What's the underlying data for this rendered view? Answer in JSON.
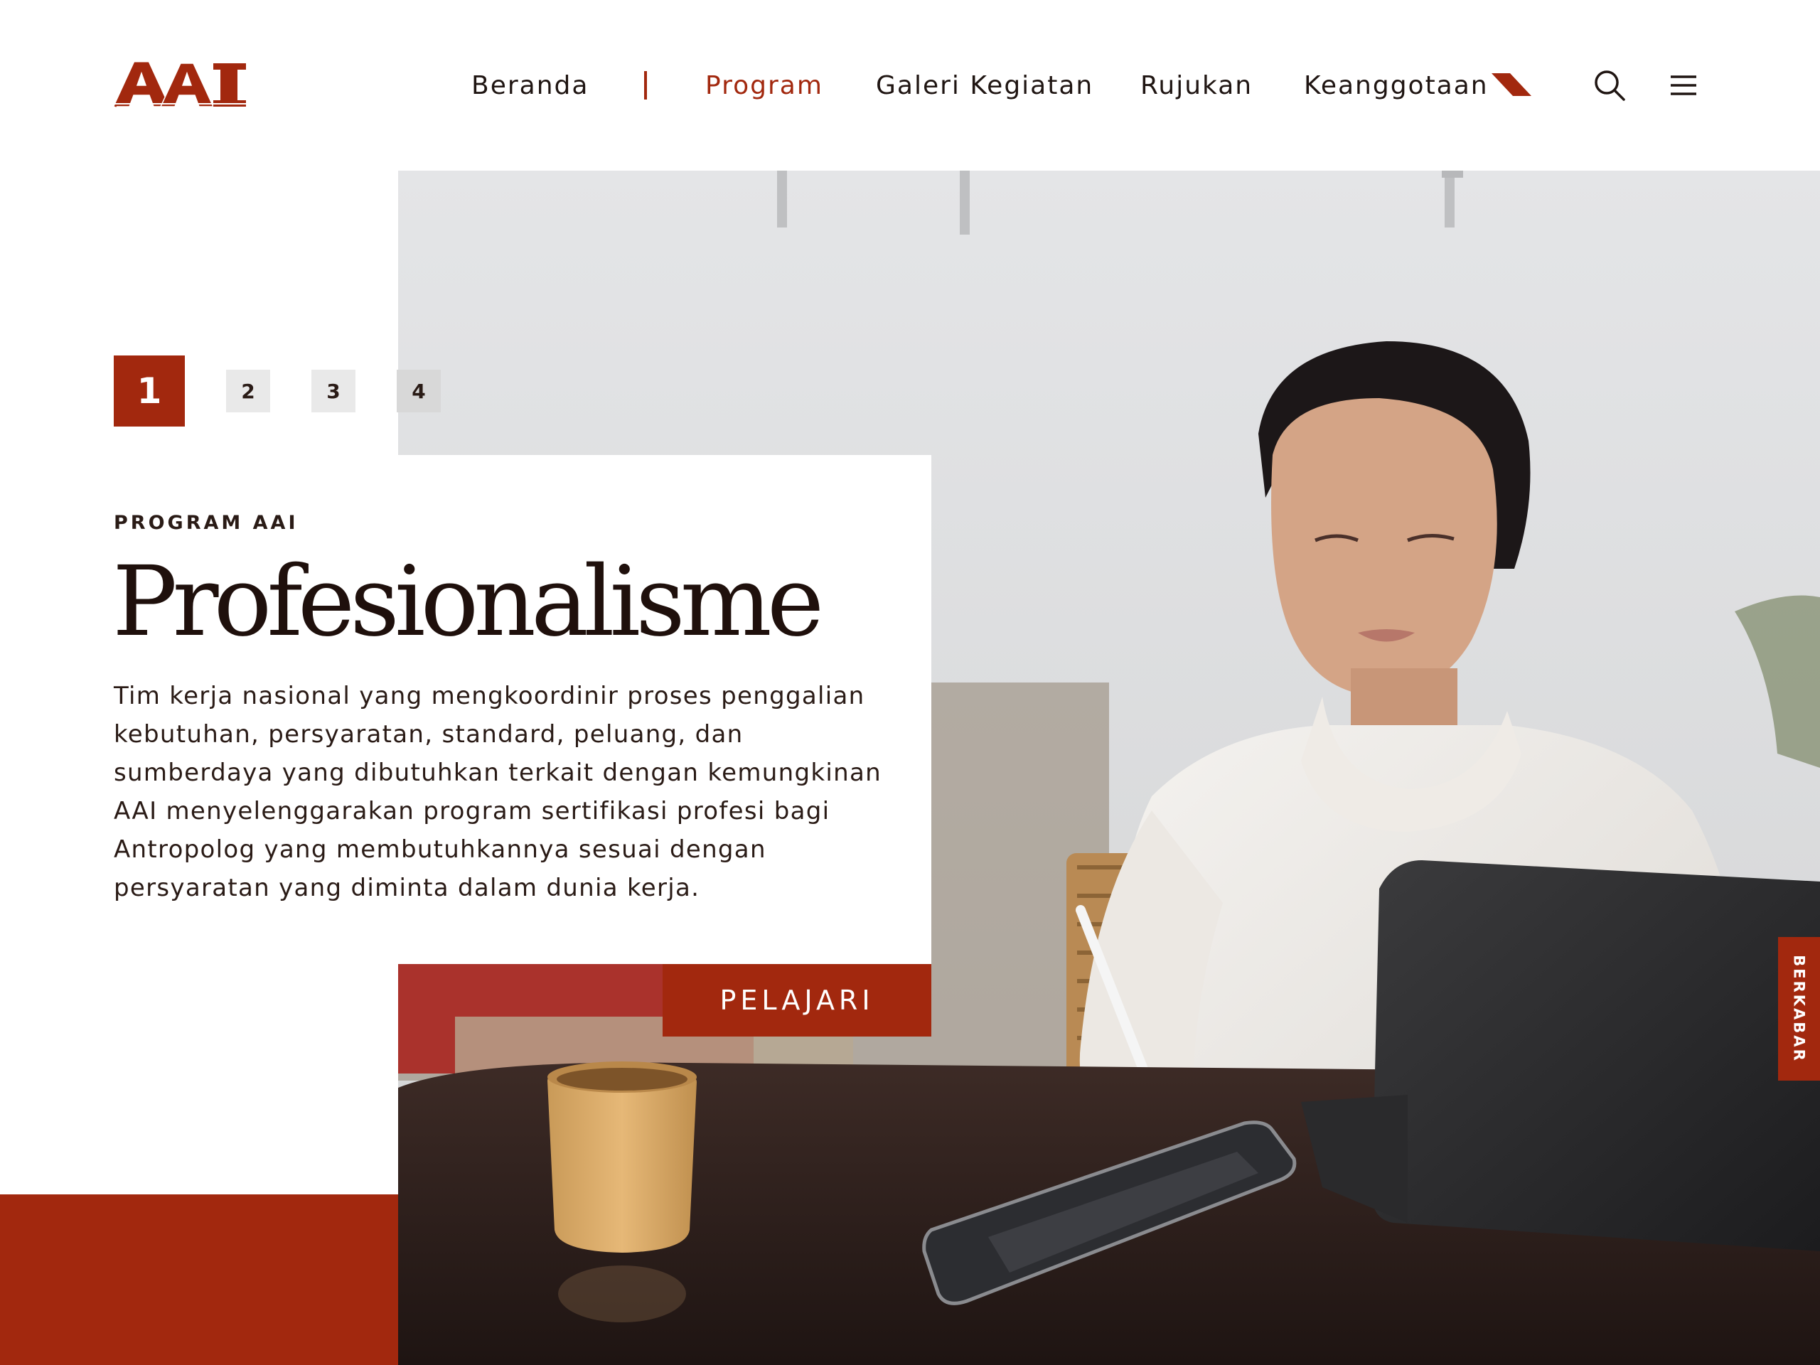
{
  "brand": {
    "logo_text": "AAI",
    "accent_color": "#a2280e",
    "text_color": "#1f100c"
  },
  "nav": {
    "items": [
      {
        "label": "Beranda",
        "active": false
      },
      {
        "label": "Program",
        "active": true
      },
      {
        "label": "Galeri Kegiatan",
        "active": false
      },
      {
        "label": "Rujukan",
        "active": false
      },
      {
        "label": "Keanggotaan",
        "active": false
      }
    ],
    "icons": [
      "search-icon",
      "hamburger-menu-icon"
    ]
  },
  "slider": {
    "pages": [
      "1",
      "2",
      "3",
      "4"
    ],
    "active_index": 0
  },
  "hero": {
    "eyebrow": "PROGRAM AAI",
    "title": "Profesionalisme",
    "description": "Tim kerja nasional yang mengkoordinir proses penggalian kebutuhan, persyaratan, standard, peluang, dan sumberdaya yang dibutuhkan terkait dengan kemungkinan AAI menyelenggarakan program sertifikasi profesi bagi Antropolog yang membutuhkannya sesuai dengan persyaratan yang diminta dalam dunia kerja.",
    "cta_label": "PELAJARI"
  },
  "side_tab": {
    "label": "BERKABAR"
  }
}
